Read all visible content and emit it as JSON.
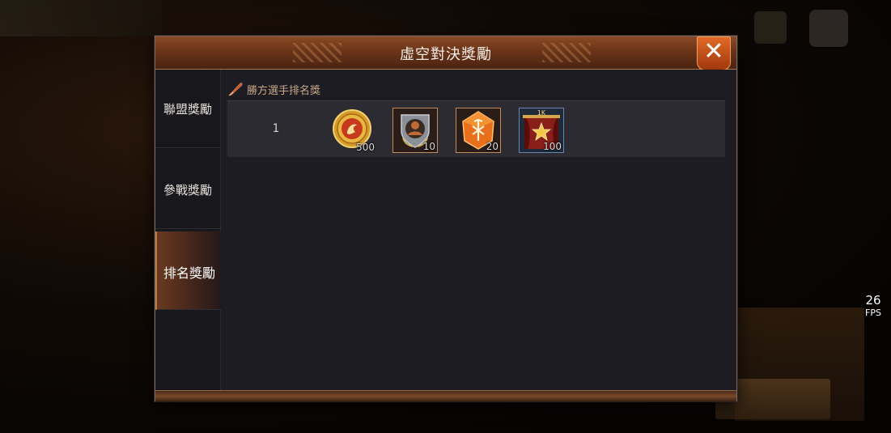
{
  "dialog": {
    "title": "虛空對決獎勵",
    "close_icon": "close-icon"
  },
  "sidebar": {
    "tabs": [
      {
        "label": "聯盟獎勵",
        "active": false
      },
      {
        "label": "參戰獎勵",
        "active": false
      },
      {
        "label": "排名獎勵",
        "active": true
      }
    ]
  },
  "content": {
    "section_title": "勝方選手排名獎",
    "rows": [
      {
        "rank": "1",
        "items": [
          {
            "icon": "dragon-coin-icon",
            "count": "500"
          },
          {
            "icon": "avatar-shield-badge-icon",
            "count": "10"
          },
          {
            "icon": "orange-rune-gem-icon",
            "count": "20"
          },
          {
            "icon": "star-banner-1k-icon",
            "count": "100",
            "badge_text": "1K"
          }
        ]
      }
    ]
  },
  "fps": {
    "value": "26",
    "label": "FPS"
  },
  "colors": {
    "title_bar": "#6a3418",
    "close_button": "#d0581c",
    "active_tab": "#6a3a20",
    "panel_bg": "#1c1c22",
    "row_bg": "#2b2b31"
  }
}
